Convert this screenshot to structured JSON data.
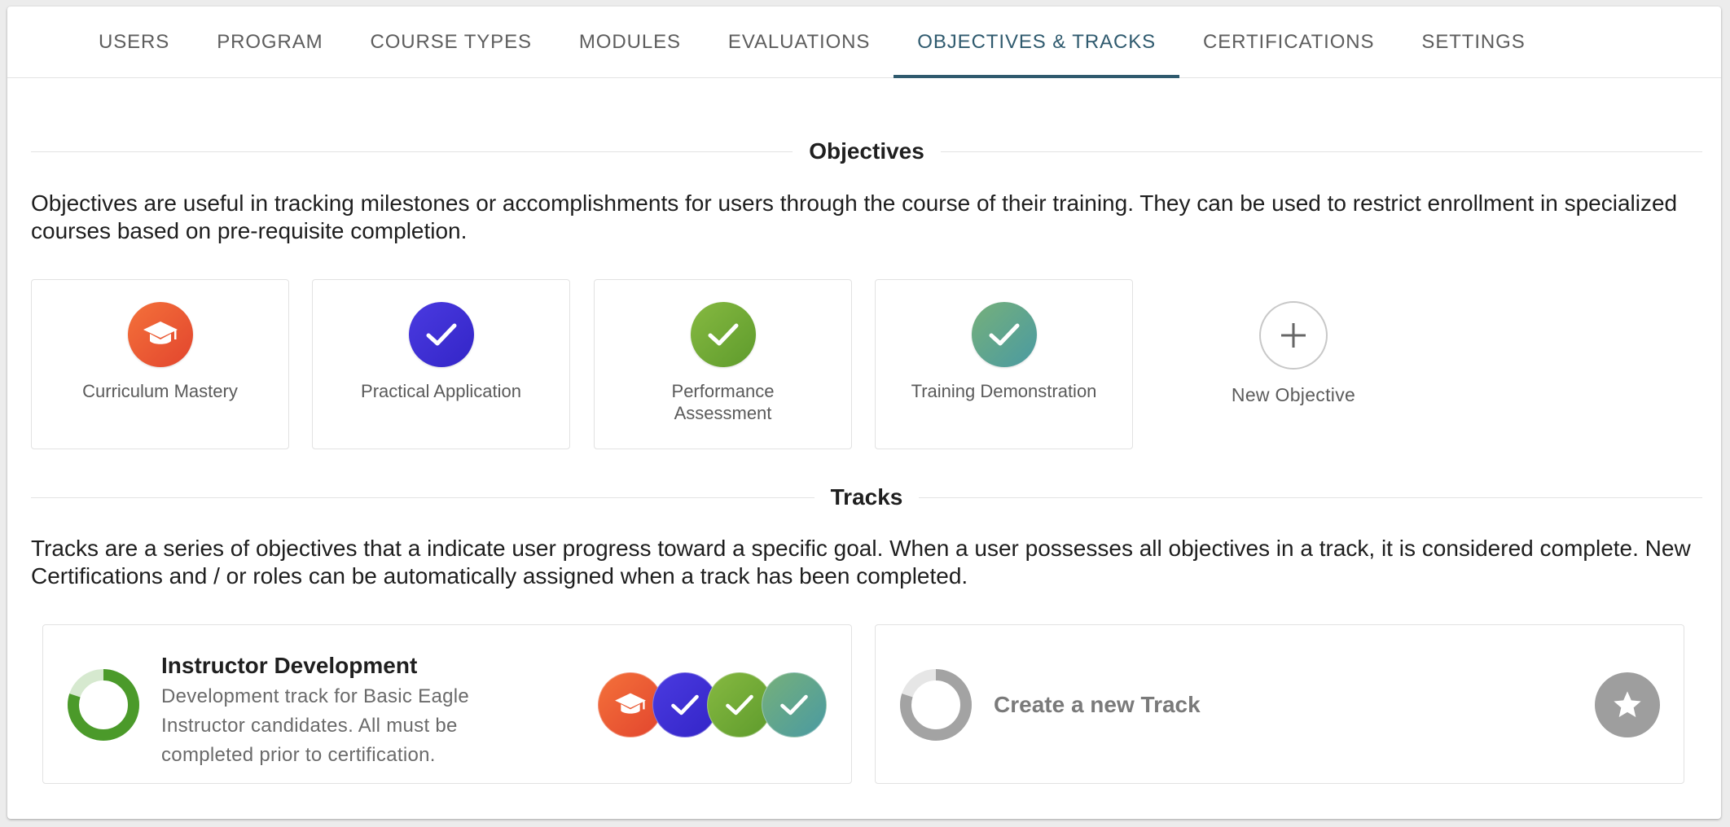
{
  "tabs": [
    {
      "label": "USERS"
    },
    {
      "label": "PROGRAM"
    },
    {
      "label": "COURSE TYPES"
    },
    {
      "label": "MODULES"
    },
    {
      "label": "EVALUATIONS"
    },
    {
      "label": "OBJECTIVES & TRACKS",
      "active": true
    },
    {
      "label": "CERTIFICATIONS"
    },
    {
      "label": "SETTINGS"
    }
  ],
  "objectives": {
    "title": "Objectives",
    "description": "Objectives are useful in tracking milestones or accomplishments for users through the course of their training. They can be used to restrict enrollment in specialized courses based on pre-requisite completion.",
    "items": [
      {
        "label": "Curriculum Mastery",
        "icon": "graduation-cap-icon",
        "color": "#e9532f"
      },
      {
        "label": "Practical Application",
        "icon": "check-icon",
        "color": "#3b2fd6"
      },
      {
        "label": "Performance Assessment",
        "icon": "check-icon",
        "color": "#6fa833"
      },
      {
        "label": "Training Demonstration",
        "icon": "check-icon",
        "color": "#5fa590"
      }
    ],
    "new_label": "New Objective"
  },
  "tracks": {
    "title": "Tracks",
    "description": "Tracks are a series of objectives that a indicate user progress toward a specific goal. When a user possesses all objectives in a track, it is considered complete. New Certifications and / or roles can be automatically assigned when a track has been completed.",
    "items": [
      {
        "title": "Instructor Development",
        "description": "Development track for Basic Eagle Instructor candidates. All must be completed prior to certification.",
        "progress": 0.8,
        "ring_color": "#4b9a2a",
        "badges": [
          "graduation-cap-icon",
          "check-icon",
          "check-icon",
          "check-icon"
        ]
      }
    ],
    "create_label": "Create a new Track",
    "create_icon": "star-icon"
  }
}
